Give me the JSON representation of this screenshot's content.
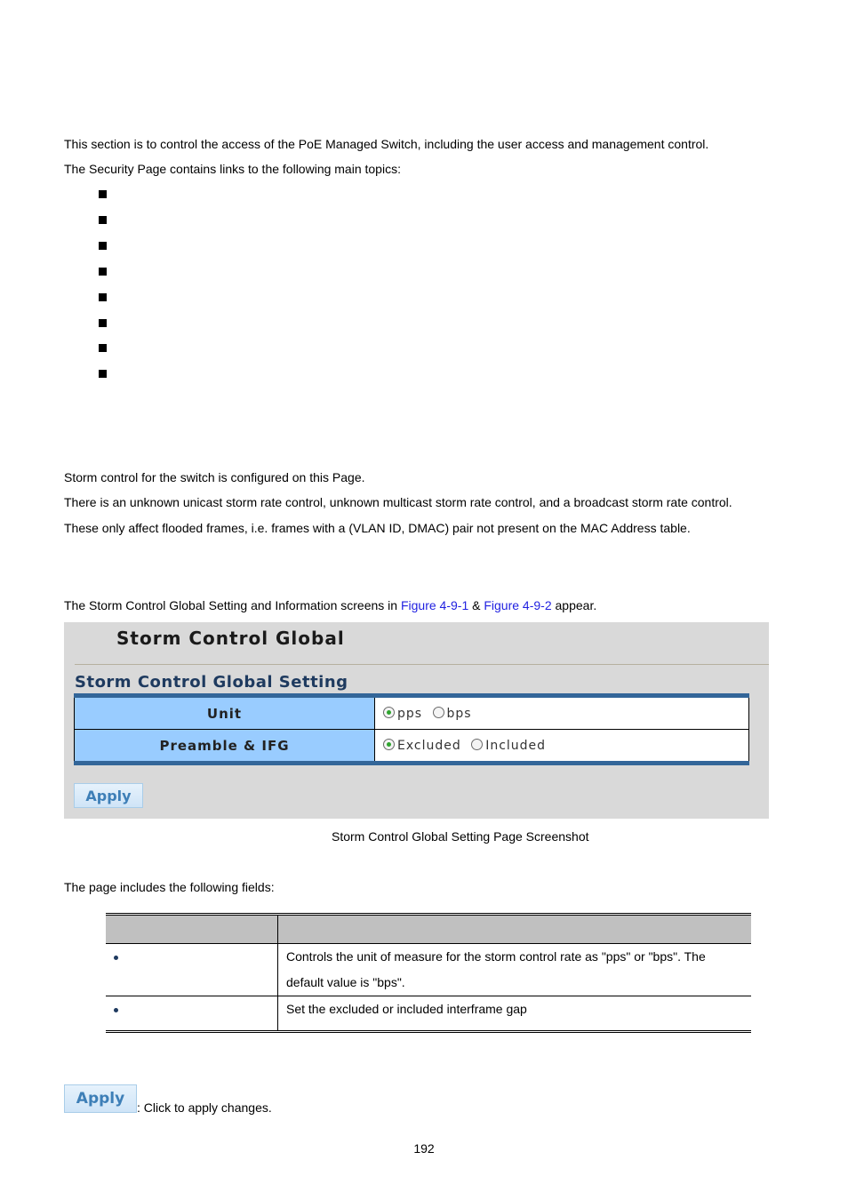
{
  "intro": {
    "line1": "This section is to control the access of the PoE Managed Switch, including the user access and management control.",
    "line2": "The Security Page contains links to the following main topics:",
    "topic_bullets": [
      "",
      "",
      "",
      "",
      "",
      "",
      "",
      ""
    ]
  },
  "storm": {
    "line1": "Storm control for the switch is configured on this Page.",
    "line2": "There is an unknown unicast storm rate control, unknown multicast storm rate control, and a broadcast storm rate control.",
    "line3": "These only affect flooded frames, i.e. frames with a (VLAN ID, DMAC) pair not present on the MAC Address table.",
    "figure_ref_prefix": "The Storm Control Global Setting and Information screens in ",
    "figure_link_1": "Figure 4-9-1",
    "figure_ref_and": " & ",
    "figure_link_2": "Figure 4-9-2",
    "figure_ref_suffix": " appear."
  },
  "screenshot": {
    "title": "Storm Control Global",
    "subtitle": "Storm Control Global Setting",
    "rows": [
      {
        "label": "Unit",
        "options": [
          {
            "label": "pps",
            "selected": true
          },
          {
            "label": "bps",
            "selected": false
          }
        ]
      },
      {
        "label": "Preamble & IFG",
        "options": [
          {
            "label": "Excluded",
            "selected": true
          },
          {
            "label": "Included",
            "selected": false
          }
        ]
      }
    ],
    "apply_label": "Apply",
    "caption": "Storm Control Global Setting Page Screenshot"
  },
  "fields_section": {
    "intro": "The page includes the following fields:",
    "headers": [
      "",
      ""
    ],
    "rows": [
      {
        "object": "",
        "description_line1": "Controls the unit of measure for the storm control rate as \"pps\" or \"bps\". The",
        "description_line2": "default value is \"bps\"."
      },
      {
        "object": "",
        "description_line1": "Set the excluded or included interframe gap",
        "description_line2": ""
      }
    ]
  },
  "buttons_section": {
    "apply_label": "Apply",
    "apply_description": ": Click to apply changes."
  },
  "footer": {
    "page_number": "192"
  }
}
